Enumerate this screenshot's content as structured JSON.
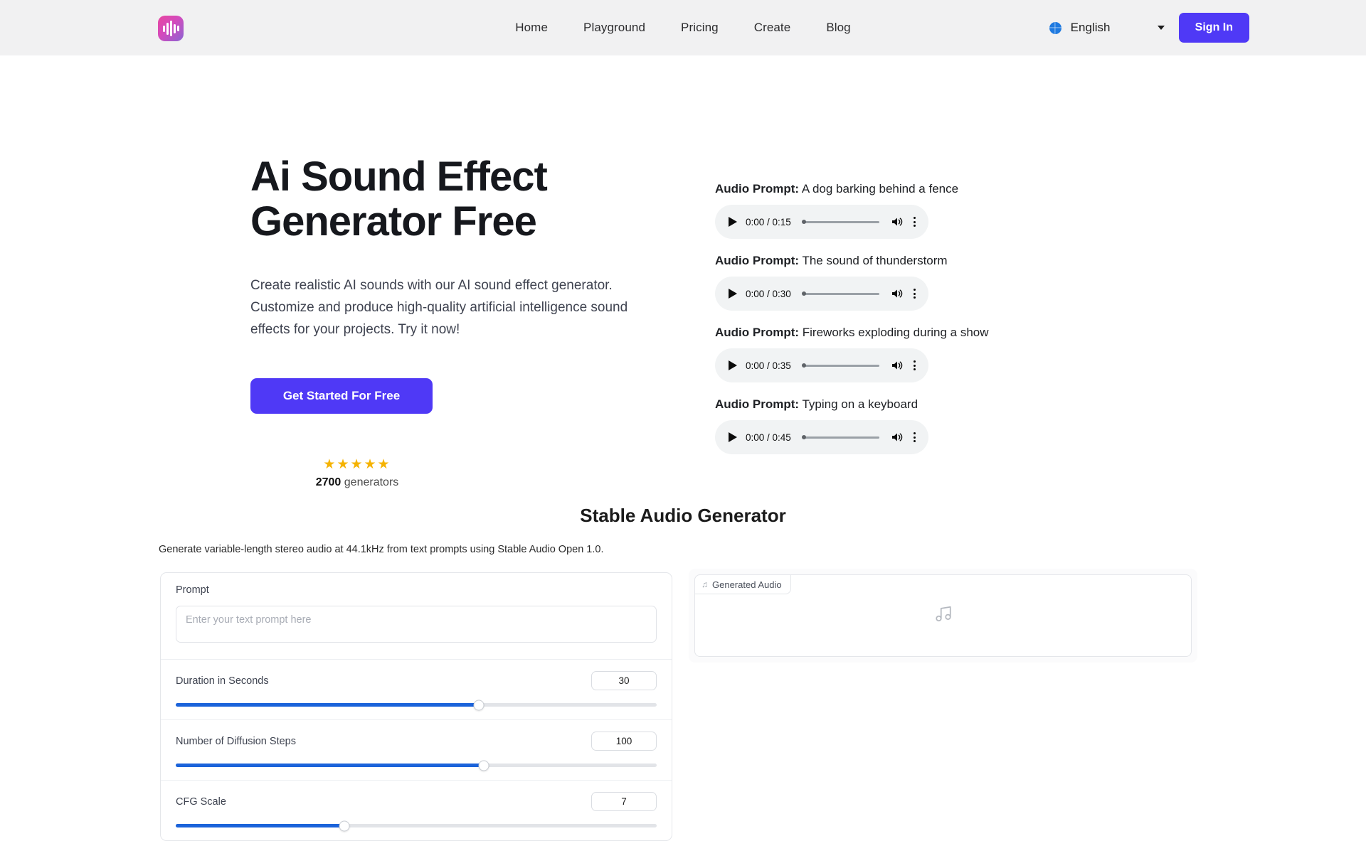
{
  "header": {
    "logo_icon": "audio-waveform-icon",
    "nav": [
      {
        "label": "Home"
      },
      {
        "label": "Playground"
      },
      {
        "label": "Pricing"
      },
      {
        "label": "Create"
      },
      {
        "label": "Blog"
      }
    ],
    "language": {
      "icon": "globe-icon",
      "selected": "English",
      "chevron": "chevron-down-icon"
    },
    "signin_label": "Sign In",
    "accent_color": "#4f39f6",
    "background_color": "#f1f1f2"
  },
  "hero": {
    "title": "Ai Sound Effect Generator Free",
    "description": "Create realistic AI sounds with our AI sound effect generator. Customize and produce high-quality artificial intelligence sound effects for your projects. Try it now!",
    "cta_label": "Get Started For Free",
    "rating": {
      "stars": "★★★★★",
      "star_count": 5,
      "star_color": "#f5b301",
      "count": "2700",
      "count_suffix": " generators"
    }
  },
  "audio_samples": {
    "label_prefix": "Audio Prompt:",
    "items": [
      {
        "prompt": " A dog barking behind a fence",
        "time": "0:00 / 0:15"
      },
      {
        "prompt": " The sound of thunderstorm",
        "time": "0:00 / 0:30"
      },
      {
        "prompt": " Fireworks exploding during a show",
        "time": "0:00 / 0:35"
      },
      {
        "prompt": " Typing on a keyboard",
        "time": "0:00 / 0:45"
      }
    ]
  },
  "generator": {
    "title": "Stable Audio Generator",
    "subtitle": "Generate variable-length stereo audio at 44.1kHz from text prompts using Stable Audio Open 1.0.",
    "form": {
      "prompt_label": "Prompt",
      "prompt_value": "",
      "prompt_placeholder": "Enter your text prompt here",
      "sliders": [
        {
          "label": "Duration in Seconds",
          "value": "30",
          "percent": 63
        },
        {
          "label": "Number of Diffusion Steps",
          "value": "100",
          "percent": 64
        },
        {
          "label": "CFG Scale",
          "value": "7",
          "percent": 35
        }
      ]
    },
    "output": {
      "tab_label": "Generated Audio",
      "tab_icon": "music-note-icon",
      "empty_icon": "music-note-icon"
    }
  }
}
